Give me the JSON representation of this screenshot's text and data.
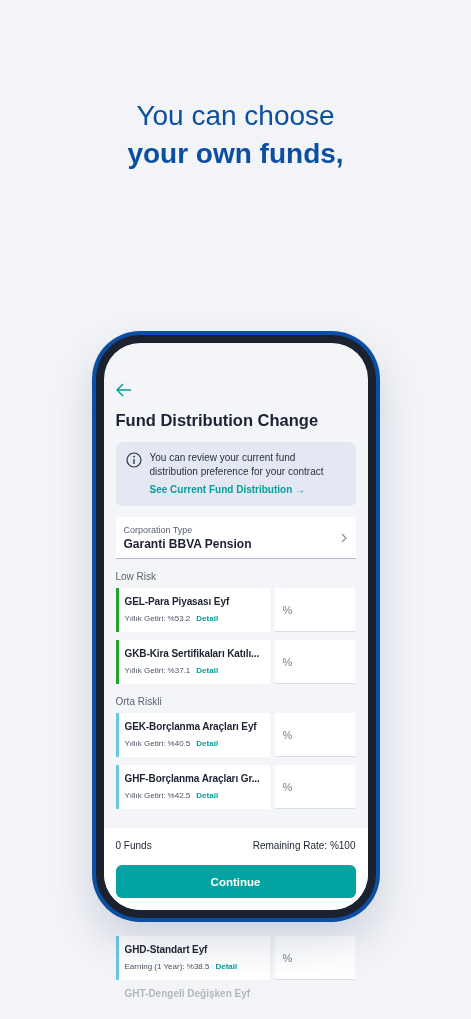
{
  "headline": {
    "line1": "You can choose",
    "line2": "your own funds,"
  },
  "screen": {
    "title": "Fund Distribution Change",
    "info": {
      "text": "You can review your current fund distribution preference for your contract",
      "link": "See Current Fund Distribution →"
    },
    "corporation": {
      "label": "Corporation Type",
      "value": "Garanti BBVA Pension"
    },
    "groups": [
      {
        "title": "Low Risk",
        "funds": [
          {
            "name": "GEL-Para Piyasası Eyf",
            "earning": "Yıllık Getiri: %53.2",
            "detail": "Detail",
            "placeholder": "%",
            "color": "#1fa22e"
          },
          {
            "name": "GKB-Kira Sertifikaları Katılı...",
            "earning": "Yıllık Getiri: %37.1",
            "detail": "Detail",
            "placeholder": "%",
            "color": "#1fa22e"
          }
        ]
      },
      {
        "title": "Orta Riskli",
        "funds": [
          {
            "name": "GEK-Borçlanma Araçları Eyf",
            "earning": "Yıllık Getiri: %40.5",
            "detail": "Detail",
            "placeholder": "%",
            "color": "#6cc6e0"
          },
          {
            "name": "GHF-Borçlanma Araçları Gr...",
            "earning": "Yıllık Getiri: %42.5",
            "detail": "Detail",
            "placeholder": "%",
            "color": "#6cc6e0"
          }
        ]
      }
    ],
    "footer": {
      "count": "0 Funds",
      "remaining": "Remaining Rate: %100",
      "button": "Continue"
    }
  },
  "below": {
    "funds": [
      {
        "name": "GHD-Standart Eyf",
        "earning": "Earning (1 Year): %38.5",
        "detail": "Detail",
        "placeholder": "%",
        "color": "#6cc6e0"
      }
    ],
    "partial": "GHT-Dengeli Değişken Eyf"
  }
}
